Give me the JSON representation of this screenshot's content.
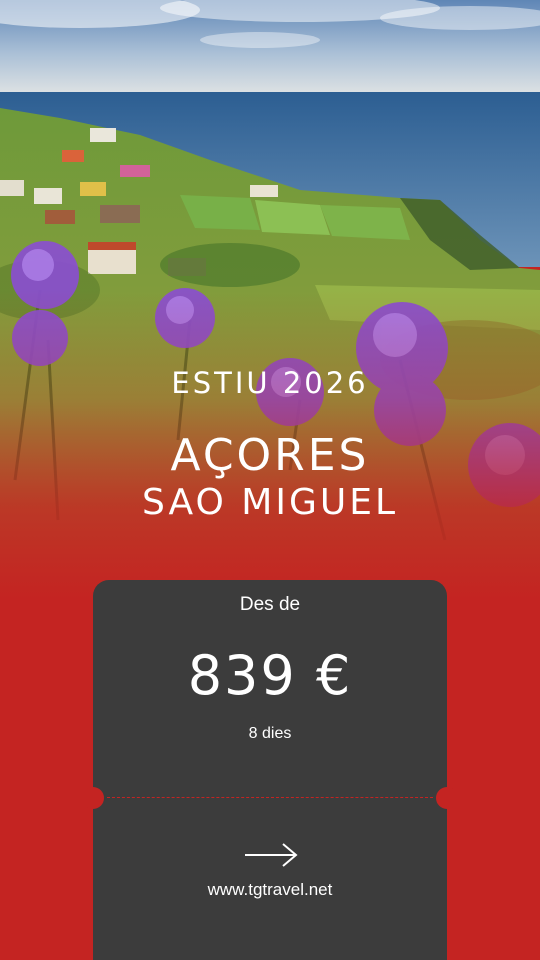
{
  "promo": {
    "season": "ESTIU 2026",
    "destination": "AÇORES",
    "island": "SAO MIGUEL"
  },
  "ticket": {
    "from_label": "Des de",
    "price": "839 €",
    "duration": "8 dies",
    "arrow_icon": "arrow-right-icon",
    "website": "www.tgtravel.net"
  },
  "colors": {
    "brand_red": "#c42422",
    "ticket_gray": "#3c3c3c"
  }
}
